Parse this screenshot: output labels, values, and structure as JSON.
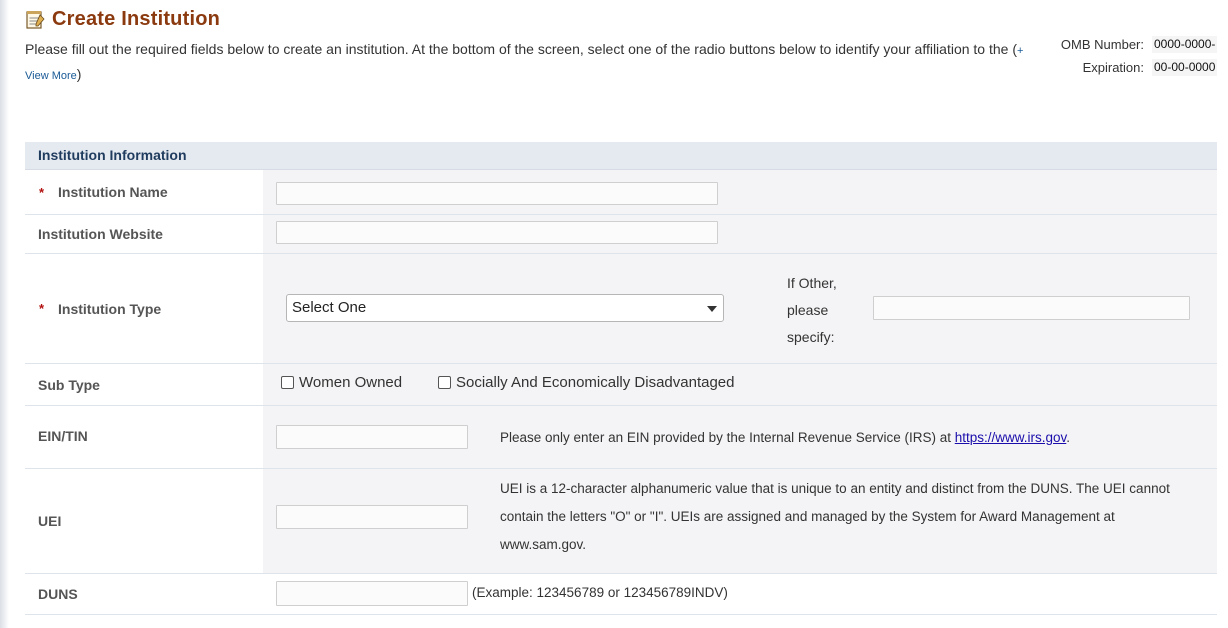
{
  "header": {
    "title": "Create Institution",
    "intro_text": "Please fill out the required fields below to create an institution. At the bottom of the screen, select one of the radio buttons below to identify your affiliation to the (",
    "view_more": "+ View More",
    "intro_close": ")"
  },
  "omb": {
    "number_label": "OMB Number:",
    "number_value": "0000-0000-",
    "expiration_label": "Expiration:",
    "expiration_value": "00-00-0000"
  },
  "section": {
    "title": "Institution Information"
  },
  "fields": {
    "institution_name": {
      "label": "Institution Name",
      "value": ""
    },
    "institution_website": {
      "label": "Institution Website",
      "value": ""
    },
    "institution_type": {
      "label": "Institution Type",
      "selected": "Select One",
      "other_label_1": "If Other,",
      "other_label_2": "please",
      "other_label_3": "specify:",
      "other_value": ""
    },
    "sub_type": {
      "label": "Sub Type",
      "option_women": "Women Owned",
      "option_disadvantaged": "Socially And Economically Disadvantaged"
    },
    "ein": {
      "label": "EIN/TIN",
      "value": "",
      "help_prefix": "Please only enter an EIN provided by the Internal Revenue Service (IRS) at ",
      "help_link": "https://www.irs.gov",
      "help_suffix": "."
    },
    "uei": {
      "label": "UEI",
      "value": "",
      "help_line1": "UEI is a 12-character alphanumeric value that is unique to an entity and distinct from the DUNS. The UEI cannot",
      "help_line2": "contain the letters \"O\" or \"I\". UEIs are assigned and managed by the System for Award Management at",
      "help_line3": "www.sam.gov."
    },
    "duns": {
      "label": "DUNS",
      "value": "",
      "example": "(Example: 123456789 or 123456789INDV)"
    }
  },
  "required_mark": "*",
  "colors": {
    "title": "#8b3a0f",
    "section_bg": "#e5e9f0",
    "required": "#b31010",
    "link": "#1a5a96"
  }
}
